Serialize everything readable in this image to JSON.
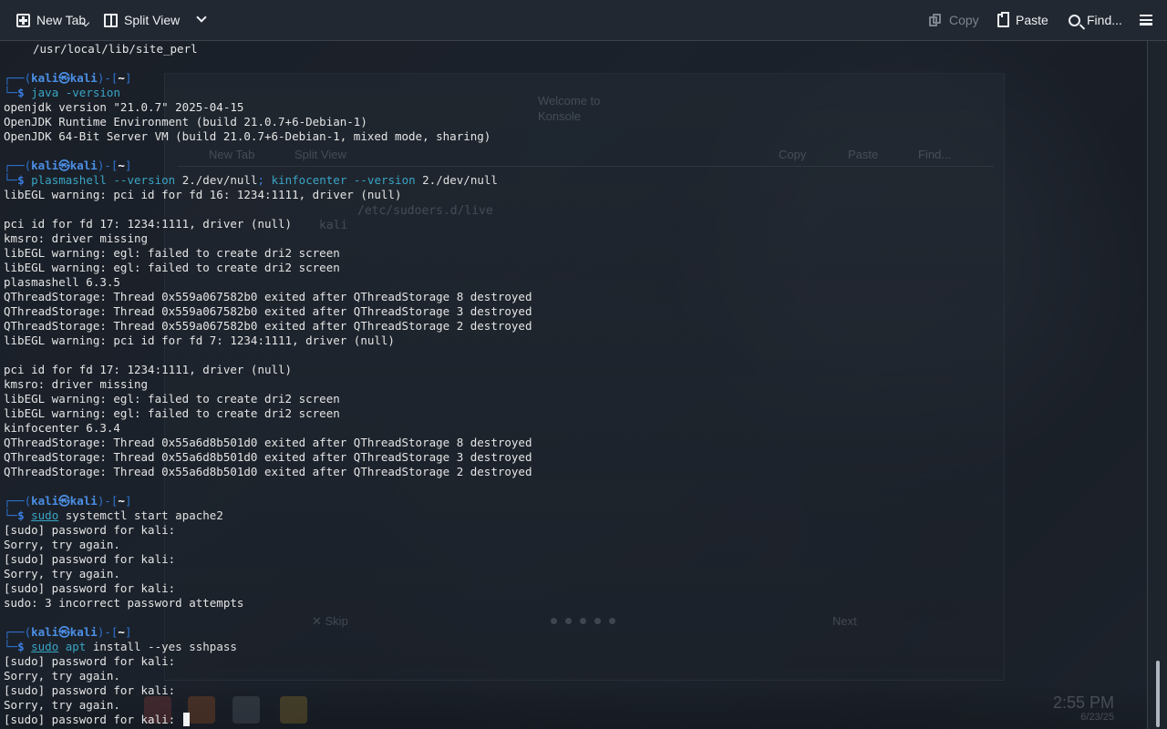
{
  "window": {
    "colors": {
      "toolbar": "#222831",
      "terminal_background": "#171c23",
      "prompt_blue": "#2e74d1",
      "command_cyan": "#39a5c6",
      "text": "#e5e5e5"
    }
  },
  "toolbar": {
    "new_tab": "New Tab",
    "split_view": "Split View",
    "copy": "Copy",
    "paste": "Paste",
    "find": "Find...",
    "icons": {
      "new_tab": "new-tab-icon",
      "split_view": "split-view-icon",
      "split_view_menu": "chevron-down-icon",
      "copy": "copy-icon",
      "paste": "paste-icon",
      "find": "search-icon",
      "menu": "hamburger-menu-icon"
    }
  },
  "prompt": {
    "top_left": "┌──(",
    "user": "kali",
    "at": "㉿",
    "host": "kali",
    "close": ")-[",
    "path": "~",
    "end": "]",
    "bottom_left": "└─",
    "dollar": "$"
  },
  "terminal": {
    "site_perl": "/usr/local/lib/site_perl",
    "cmd1": {
      "name": "java",
      "args": " -version"
    },
    "java_output": [
      "openjdk version \"21.0.7\" 2025-04-15",
      "OpenJDK Runtime Environment (build 21.0.7+6-Debian-1)",
      "OpenJDK 64-Bit Server VM (build 21.0.7+6-Debian-1, mixed mode, sharing)"
    ],
    "cmd2": {
      "part1": "plasmashell",
      "part2": " --version ",
      "part3": "2./dev/null",
      "semicolon": ";",
      "part4": " kinfocenter",
      "part5": " --version ",
      "part6": "2./dev/null"
    },
    "plasma_output": [
      "libEGL warning: pci id for fd 16: 1234:1111, driver (null)",
      "",
      "pci id for fd 17: 1234:1111, driver (null)",
      "kmsro: driver missing",
      "libEGL warning: egl: failed to create dri2 screen",
      "libEGL warning: egl: failed to create dri2 screen",
      "plasmashell 6.3.5",
      "QThreadStorage: Thread 0x559a067582b0 exited after QThreadStorage 8 destroyed",
      "QThreadStorage: Thread 0x559a067582b0 exited after QThreadStorage 3 destroyed",
      "QThreadStorage: Thread 0x559a067582b0 exited after QThreadStorage 2 destroyed",
      "libEGL warning: pci id for fd 7: 1234:1111, driver (null)",
      "",
      "pci id for fd 17: 1234:1111, driver (null)",
      "kmsro: driver missing",
      "libEGL warning: egl: failed to create dri2 screen",
      "libEGL warning: egl: failed to create dri2 screen",
      "kinfocenter 6.3.4",
      "QThreadStorage: Thread 0x55a6d8b501d0 exited after QThreadStorage 8 destroyed",
      "QThreadStorage: Thread 0x55a6d8b501d0 exited after QThreadStorage 3 destroyed",
      "QThreadStorage: Thread 0x55a6d8b501d0 exited after QThreadStorage 2 destroyed"
    ],
    "cmd3": {
      "sudo": "sudo",
      "name": " systemctl",
      "args": " start apache2"
    },
    "sudo_output_1": [
      "[sudo] password for kali:",
      "Sorry, try again.",
      "[sudo] password for kali:",
      "Sorry, try again.",
      "[sudo] password for kali:",
      "sudo: 3 incorrect password attempts"
    ],
    "cmd4": {
      "sudo": "sudo",
      "name": " apt",
      "args": " install --yes sshpass"
    },
    "sudo_output_2": [
      "[sudo] password for kali:",
      "Sorry, try again.",
      "[sudo] password for kali:",
      "Sorry, try again."
    ],
    "current_prompt": "[sudo] password for kali: "
  },
  "ghosts": {
    "top_a": "Welcome to",
    "top_b": "Konsole",
    "new_tab": "New Tab",
    "split_view": "Split View",
    "copy": "Copy",
    "paste": "Paste",
    "find": "Find...",
    "file_text": "/etc/sudoers.d/live",
    "prompt": "kali",
    "skip": "✕ Skip",
    "next": "Next",
    "time": "2:55 PM",
    "date": "6/23/25"
  }
}
